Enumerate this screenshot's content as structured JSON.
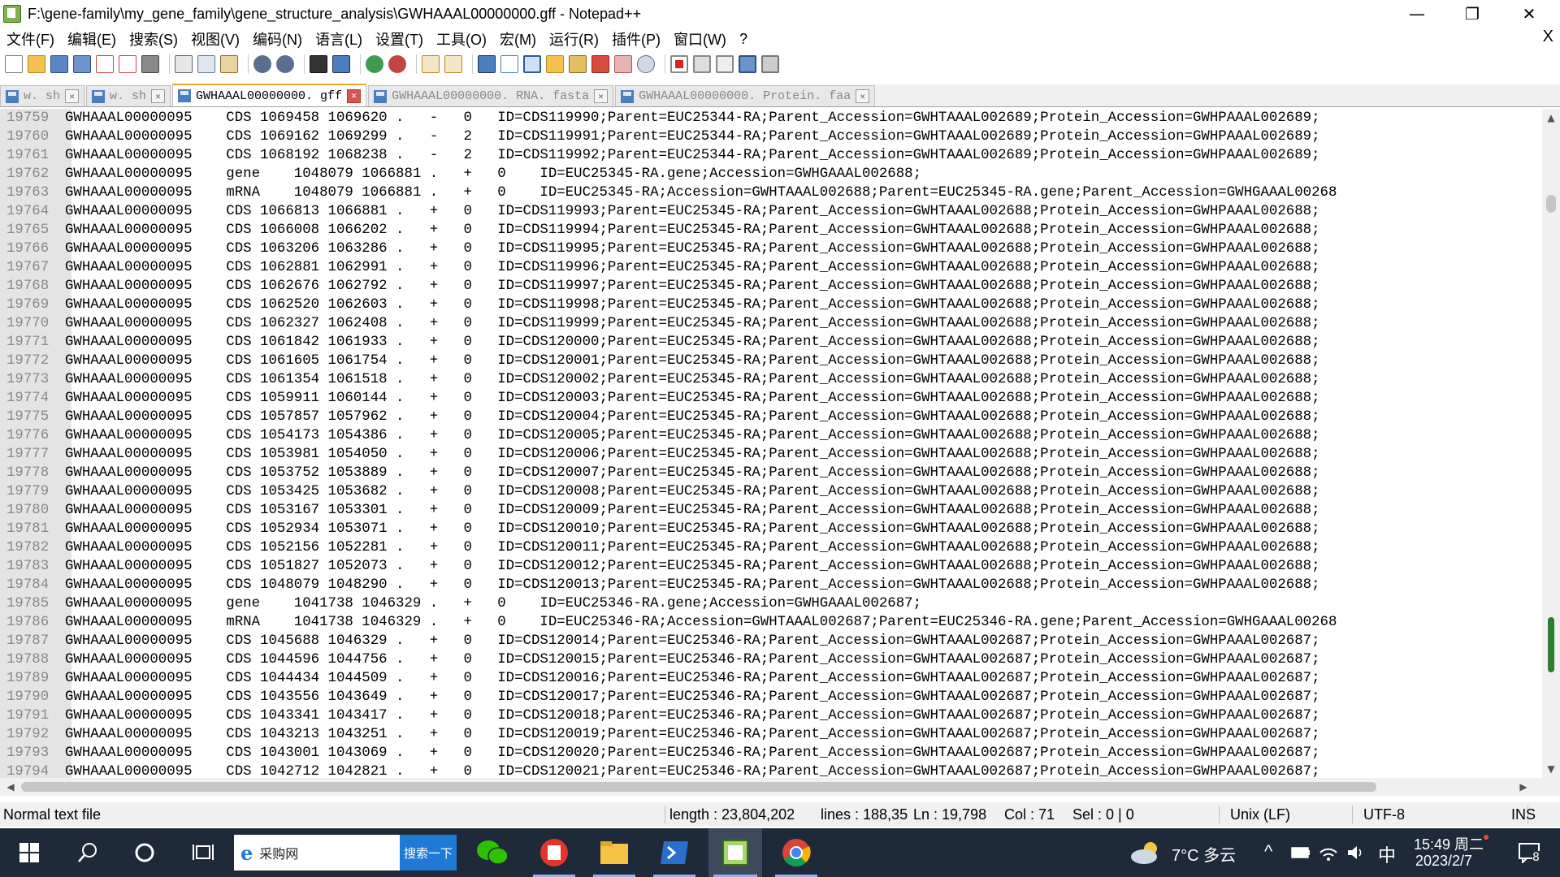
{
  "window": {
    "title": "F:\\gene-family\\my_gene_family\\gene_structure_analysis\\GWHAAAL00000000.gff - Notepad++",
    "minimize": "—",
    "maximize": "❐",
    "close": "✕"
  },
  "menu": {
    "items": [
      "文件(F)",
      "编辑(E)",
      "搜索(S)",
      "视图(V)",
      "编码(N)",
      "语言(L)",
      "设置(T)",
      "工具(O)",
      "宏(M)",
      "运行(R)",
      "插件(P)",
      "窗口(W)",
      "?"
    ],
    "close_doc": "X"
  },
  "toolbar": {
    "buttons": [
      "new-file",
      "open-file",
      "save",
      "save-all",
      "close",
      "close-all",
      "print",
      "cut",
      "copy",
      "paste",
      "undo",
      "redo",
      "find",
      "replace",
      "zoom-in",
      "zoom-out",
      "sync-vertical",
      "sync-horizontal",
      "word-wrap",
      "show-all-chars",
      "indent-guide",
      "user-language",
      "doc-map",
      "function-list",
      "folder-workspace",
      "monitoring",
      "record-macro",
      "stop-recording",
      "playback-macro",
      "run-macro-multiple",
      "save-macro"
    ]
  },
  "tabs": [
    {
      "label": "w. sh",
      "active": false
    },
    {
      "label": "w. sh",
      "active": false
    },
    {
      "label": "GWHAAAL00000000. gff",
      "active": true
    },
    {
      "label": "GWHAAAL00000000. RNA. fasta",
      "active": false
    },
    {
      "label": "GWHAAAL00000000. Protein. faa",
      "active": false
    }
  ],
  "editor": {
    "lines": [
      {
        "n": "19759",
        "text": "GWHAAAL00000095    CDS 1069458 1069620 .   -   0   ID=CDS119990;Parent=EUC25344-RA;Parent_Accession=GWHTAAAL002689;Protein_Accession=GWHPAAAL002689;"
      },
      {
        "n": "19760",
        "text": "GWHAAAL00000095    CDS 1069162 1069299 .   -   2   ID=CDS119991;Parent=EUC25344-RA;Parent_Accession=GWHTAAAL002689;Protein_Accession=GWHPAAAL002689;"
      },
      {
        "n": "19761",
        "text": "GWHAAAL00000095    CDS 1068192 1068238 .   -   2   ID=CDS119992;Parent=EUC25344-RA;Parent_Accession=GWHTAAAL002689;Protein_Accession=GWHPAAAL002689;"
      },
      {
        "n": "19762",
        "text": "GWHAAAL00000095    gene    1048079 1066881 .   +   0    ID=EUC25345-RA.gene;Accession=GWHGAAAL002688;"
      },
      {
        "n": "19763",
        "text": "GWHAAAL00000095    mRNA    1048079 1066881 .   +   0    ID=EUC25345-RA;Accession=GWHTAAAL002688;Parent=EUC25345-RA.gene;Parent_Accession=GWHGAAAL00268"
      },
      {
        "n": "19764",
        "text": "GWHAAAL00000095    CDS 1066813 1066881 .   +   0   ID=CDS119993;Parent=EUC25345-RA;Parent_Accession=GWHTAAAL002688;Protein_Accession=GWHPAAAL002688;"
      },
      {
        "n": "19765",
        "text": "GWHAAAL00000095    CDS 1066008 1066202 .   +   0   ID=CDS119994;Parent=EUC25345-RA;Parent_Accession=GWHTAAAL002688;Protein_Accession=GWHPAAAL002688;"
      },
      {
        "n": "19766",
        "text": "GWHAAAL00000095    CDS 1063206 1063286 .   +   0   ID=CDS119995;Parent=EUC25345-RA;Parent_Accession=GWHTAAAL002688;Protein_Accession=GWHPAAAL002688;"
      },
      {
        "n": "19767",
        "text": "GWHAAAL00000095    CDS 1062881 1062991 .   +   0   ID=CDS119996;Parent=EUC25345-RA;Parent_Accession=GWHTAAAL002688;Protein_Accession=GWHPAAAL002688;"
      },
      {
        "n": "19768",
        "text": "GWHAAAL00000095    CDS 1062676 1062792 .   +   0   ID=CDS119997;Parent=EUC25345-RA;Parent_Accession=GWHTAAAL002688;Protein_Accession=GWHPAAAL002688;"
      },
      {
        "n": "19769",
        "text": "GWHAAAL00000095    CDS 1062520 1062603 .   +   0   ID=CDS119998;Parent=EUC25345-RA;Parent_Accession=GWHTAAAL002688;Protein_Accession=GWHPAAAL002688;"
      },
      {
        "n": "19770",
        "text": "GWHAAAL00000095    CDS 1062327 1062408 .   +   0   ID=CDS119999;Parent=EUC25345-RA;Parent_Accession=GWHTAAAL002688;Protein_Accession=GWHPAAAL002688;"
      },
      {
        "n": "19771",
        "text": "GWHAAAL00000095    CDS 1061842 1061933 .   +   0   ID=CDS120000;Parent=EUC25345-RA;Parent_Accession=GWHTAAAL002688;Protein_Accession=GWHPAAAL002688;"
      },
      {
        "n": "19772",
        "text": "GWHAAAL00000095    CDS 1061605 1061754 .   +   0   ID=CDS120001;Parent=EUC25345-RA;Parent_Accession=GWHTAAAL002688;Protein_Accession=GWHPAAAL002688;"
      },
      {
        "n": "19773",
        "text": "GWHAAAL00000095    CDS 1061354 1061518 .   +   0   ID=CDS120002;Parent=EUC25345-RA;Parent_Accession=GWHTAAAL002688;Protein_Accession=GWHPAAAL002688;"
      },
      {
        "n": "19774",
        "text": "GWHAAAL00000095    CDS 1059911 1060144 .   +   0   ID=CDS120003;Parent=EUC25345-RA;Parent_Accession=GWHTAAAL002688;Protein_Accession=GWHPAAAL002688;"
      },
      {
        "n": "19775",
        "text": "GWHAAAL00000095    CDS 1057857 1057962 .   +   0   ID=CDS120004;Parent=EUC25345-RA;Parent_Accession=GWHTAAAL002688;Protein_Accession=GWHPAAAL002688;"
      },
      {
        "n": "19776",
        "text": "GWHAAAL00000095    CDS 1054173 1054386 .   +   0   ID=CDS120005;Parent=EUC25345-RA;Parent_Accession=GWHTAAAL002688;Protein_Accession=GWHPAAAL002688;"
      },
      {
        "n": "19777",
        "text": "GWHAAAL00000095    CDS 1053981 1054050 .   +   0   ID=CDS120006;Parent=EUC25345-RA;Parent_Accession=GWHTAAAL002688;Protein_Accession=GWHPAAAL002688;"
      },
      {
        "n": "19778",
        "text": "GWHAAAL00000095    CDS 1053752 1053889 .   +   0   ID=CDS120007;Parent=EUC25345-RA;Parent_Accession=GWHTAAAL002688;Protein_Accession=GWHPAAAL002688;"
      },
      {
        "n": "19779",
        "text": "GWHAAAL00000095    CDS 1053425 1053682 .   +   0   ID=CDS120008;Parent=EUC25345-RA;Parent_Accession=GWHTAAAL002688;Protein_Accession=GWHPAAAL002688;"
      },
      {
        "n": "19780",
        "text": "GWHAAAL00000095    CDS 1053167 1053301 .   +   0   ID=CDS120009;Parent=EUC25345-RA;Parent_Accession=GWHTAAAL002688;Protein_Accession=GWHPAAAL002688;"
      },
      {
        "n": "19781",
        "text": "GWHAAAL00000095    CDS 1052934 1053071 .   +   0   ID=CDS120010;Parent=EUC25345-RA;Parent_Accession=GWHTAAAL002688;Protein_Accession=GWHPAAAL002688;"
      },
      {
        "n": "19782",
        "text": "GWHAAAL00000095    CDS 1052156 1052281 .   +   0   ID=CDS120011;Parent=EUC25345-RA;Parent_Accession=GWHTAAAL002688;Protein_Accession=GWHPAAAL002688;"
      },
      {
        "n": "19783",
        "text": "GWHAAAL00000095    CDS 1051827 1052073 .   +   0   ID=CDS120012;Parent=EUC25345-RA;Parent_Accession=GWHTAAAL002688;Protein_Accession=GWHPAAAL002688;"
      },
      {
        "n": "19784",
        "text": "GWHAAAL00000095    CDS 1048079 1048290 .   +   0   ID=CDS120013;Parent=EUC25345-RA;Parent_Accession=GWHTAAAL002688;Protein_Accession=GWHPAAAL002688;"
      },
      {
        "n": "19785",
        "text": "GWHAAAL00000095    gene    1041738 1046329 .   +   0    ID=EUC25346-RA.gene;Accession=GWHGAAAL002687;"
      },
      {
        "n": "19786",
        "text": "GWHAAAL00000095    mRNA    1041738 1046329 .   +   0    ID=EUC25346-RA;Accession=GWHTAAAL002687;Parent=EUC25346-RA.gene;Parent_Accession=GWHGAAAL00268"
      },
      {
        "n": "19787",
        "text": "GWHAAAL00000095    CDS 1045688 1046329 .   +   0   ID=CDS120014;Parent=EUC25346-RA;Parent_Accession=GWHTAAAL002687;Protein_Accession=GWHPAAAL002687;"
      },
      {
        "n": "19788",
        "text": "GWHAAAL00000095    CDS 1044596 1044756 .   +   0   ID=CDS120015;Parent=EUC25346-RA;Parent_Accession=GWHTAAAL002687;Protein_Accession=GWHPAAAL002687;"
      },
      {
        "n": "19789",
        "text": "GWHAAAL00000095    CDS 1044434 1044509 .   +   0   ID=CDS120016;Parent=EUC25346-RA;Parent_Accession=GWHTAAAL002687;Protein_Accession=GWHPAAAL002687;"
      },
      {
        "n": "19790",
        "text": "GWHAAAL00000095    CDS 1043556 1043649 .   +   0   ID=CDS120017;Parent=EUC25346-RA;Parent_Accession=GWHTAAAL002687;Protein_Accession=GWHPAAAL002687;"
      },
      {
        "n": "19791",
        "text": "GWHAAAL00000095    CDS 1043341 1043417 .   +   0   ID=CDS120018;Parent=EUC25346-RA;Parent_Accession=GWHTAAAL002687;Protein_Accession=GWHPAAAL002687;"
      },
      {
        "n": "19792",
        "text": "GWHAAAL00000095    CDS 1043213 1043251 .   +   0   ID=CDS120019;Parent=EUC25346-RA;Parent_Accession=GWHTAAAL002687;Protein_Accession=GWHPAAAL002687;"
      },
      {
        "n": "19793",
        "text": "GWHAAAL00000095    CDS 1043001 1043069 .   +   0   ID=CDS120020;Parent=EUC25346-RA;Parent_Accession=GWHTAAAL002687;Protein_Accession=GWHPAAAL002687;"
      },
      {
        "n": "19794",
        "text": "GWHAAAL00000095    CDS 1042712 1042821 .   +   0   ID=CDS120021;Parent=EUC25346-RA;Parent_Accession=GWHTAAAL002687;Protein_Accession=GWHPAAAL002687;"
      }
    ]
  },
  "statusbar": {
    "file_type": "Normal text file",
    "length": "length : 23,804,202",
    "lines": "lines : 188,35",
    "ln": "Ln : 19,798",
    "col": "Col : 71",
    "sel": "Sel : 0 | 0",
    "eol": "Unix (LF)",
    "encoding": "UTF-8",
    "mode": "INS"
  },
  "taskbar": {
    "search_text": "采购网",
    "search_button": "搜索一下",
    "weather": "7°C  多云",
    "ime": "中",
    "time": "15:49 周二",
    "date": "2023/2/7",
    "notifications": "8"
  },
  "colors": {
    "gutter": "#e4e4e4",
    "active_tab_accent": "#f5a623",
    "taskbar": "#1e2a3a",
    "search_button": "#1f7ad6"
  }
}
